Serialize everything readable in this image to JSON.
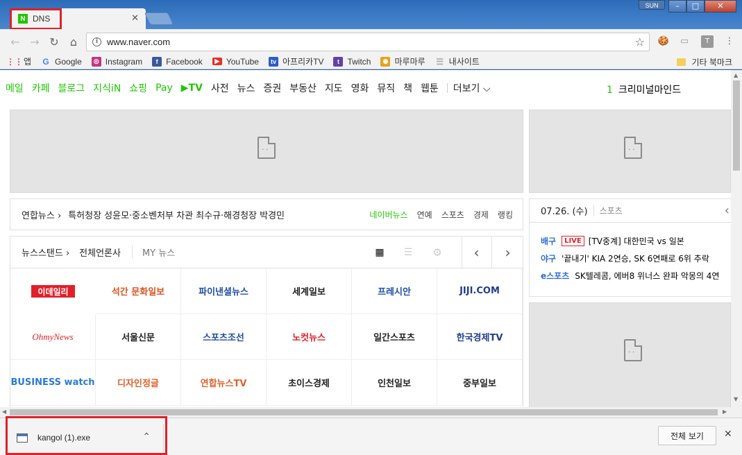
{
  "window": {
    "tab_title": "DNS",
    "favicon_letter": "N",
    "user_label": "SUN"
  },
  "toolbar": {
    "url": "www.naver.com"
  },
  "bookmarks": {
    "items": [
      {
        "label": "앱",
        "icon": "apps-grid-icon"
      },
      {
        "label": "Google",
        "icon": "google-icon"
      },
      {
        "label": "Instagram",
        "icon": "instagram-icon"
      },
      {
        "label": "Facebook",
        "icon": "facebook-icon"
      },
      {
        "label": "YouTube",
        "icon": "youtube-icon"
      },
      {
        "label": "아프리카TV",
        "icon": "afreecatv-icon"
      },
      {
        "label": "Twitch",
        "icon": "twitch-icon"
      },
      {
        "label": "마루마루",
        "icon": "marumaru-icon"
      },
      {
        "label": "내사이트",
        "icon": "page-icon"
      }
    ],
    "other_label": "기타 북마크"
  },
  "naver": {
    "menu": [
      "메일",
      "카페",
      "블로그",
      "지식iN",
      "쇼핑",
      "Pay",
      "▶TV",
      "사전",
      "뉴스",
      "증권",
      "부동산",
      "지도",
      "영화",
      "뮤직",
      "책",
      "웹툰"
    ],
    "more_label": "더보기",
    "trend_rank": "1",
    "trend_text": "크리미널마인드",
    "news_source": "연합뉴스",
    "news_headline": "특허청장 성윤모·중소벤처부 차관 최수규·해경청장 박경민",
    "news_links": [
      "네이버뉴스",
      "연예",
      "스포츠",
      "경제",
      "랭킹"
    ],
    "newsstand_label": "뉴스스탠드",
    "all_press_label": "전체언론사",
    "my_news_label": "MY 뉴스",
    "press": [
      {
        "name": "이데일리",
        "color": "#e0202a"
      },
      {
        "name": "석간 문화일보",
        "color": "#d9531e"
      },
      {
        "name": "파이낸셜뉴스",
        "color": "#1f4ea3"
      },
      {
        "name": "세계일보",
        "color": "#222222"
      },
      {
        "name": "프레시안",
        "color": "#1f4ea3"
      },
      {
        "name": "JIJI.COM",
        "color": "#1f3f8a"
      },
      {
        "name": "OhmyNews",
        "color": "#e0202a"
      },
      {
        "name": "서울신문",
        "color": "#222222"
      },
      {
        "name": "스포츠조선",
        "color": "#1f4ea3"
      },
      {
        "name": "노컷뉴스",
        "color": "#e0202a"
      },
      {
        "name": "일간스포츠",
        "color": "#222222"
      },
      {
        "name": "한국경제TV",
        "color": "#1f3f8a"
      },
      {
        "name": "BUSINESS watch",
        "color": "#2a7bd5"
      },
      {
        "name": "디자인정글",
        "color": "#e0602a"
      },
      {
        "name": "연합뉴스TV",
        "color": "#e0602a"
      },
      {
        "name": "초이스경제",
        "color": "#222222"
      },
      {
        "name": "인천일보",
        "color": "#222222"
      },
      {
        "name": "중부일보",
        "color": "#222222"
      }
    ],
    "date_label": "07.26. (수)",
    "date_tag": "스포츠",
    "sports": [
      {
        "category": "배구",
        "live": "LIVE",
        "text": "[TV중계] 대한민국 vs 일본"
      },
      {
        "category": "야구",
        "live": "",
        "text": "'끝내기' KIA 2연승, SK 6연패로 6위 추락"
      },
      {
        "category": "e스포츠",
        "live": "",
        "text": "SK텔레콤, 에버8 위너스 완파 악몽의 4연"
      }
    ]
  },
  "download": {
    "file_name": "kangol (1).exe",
    "show_all_label": "전체 보기"
  }
}
